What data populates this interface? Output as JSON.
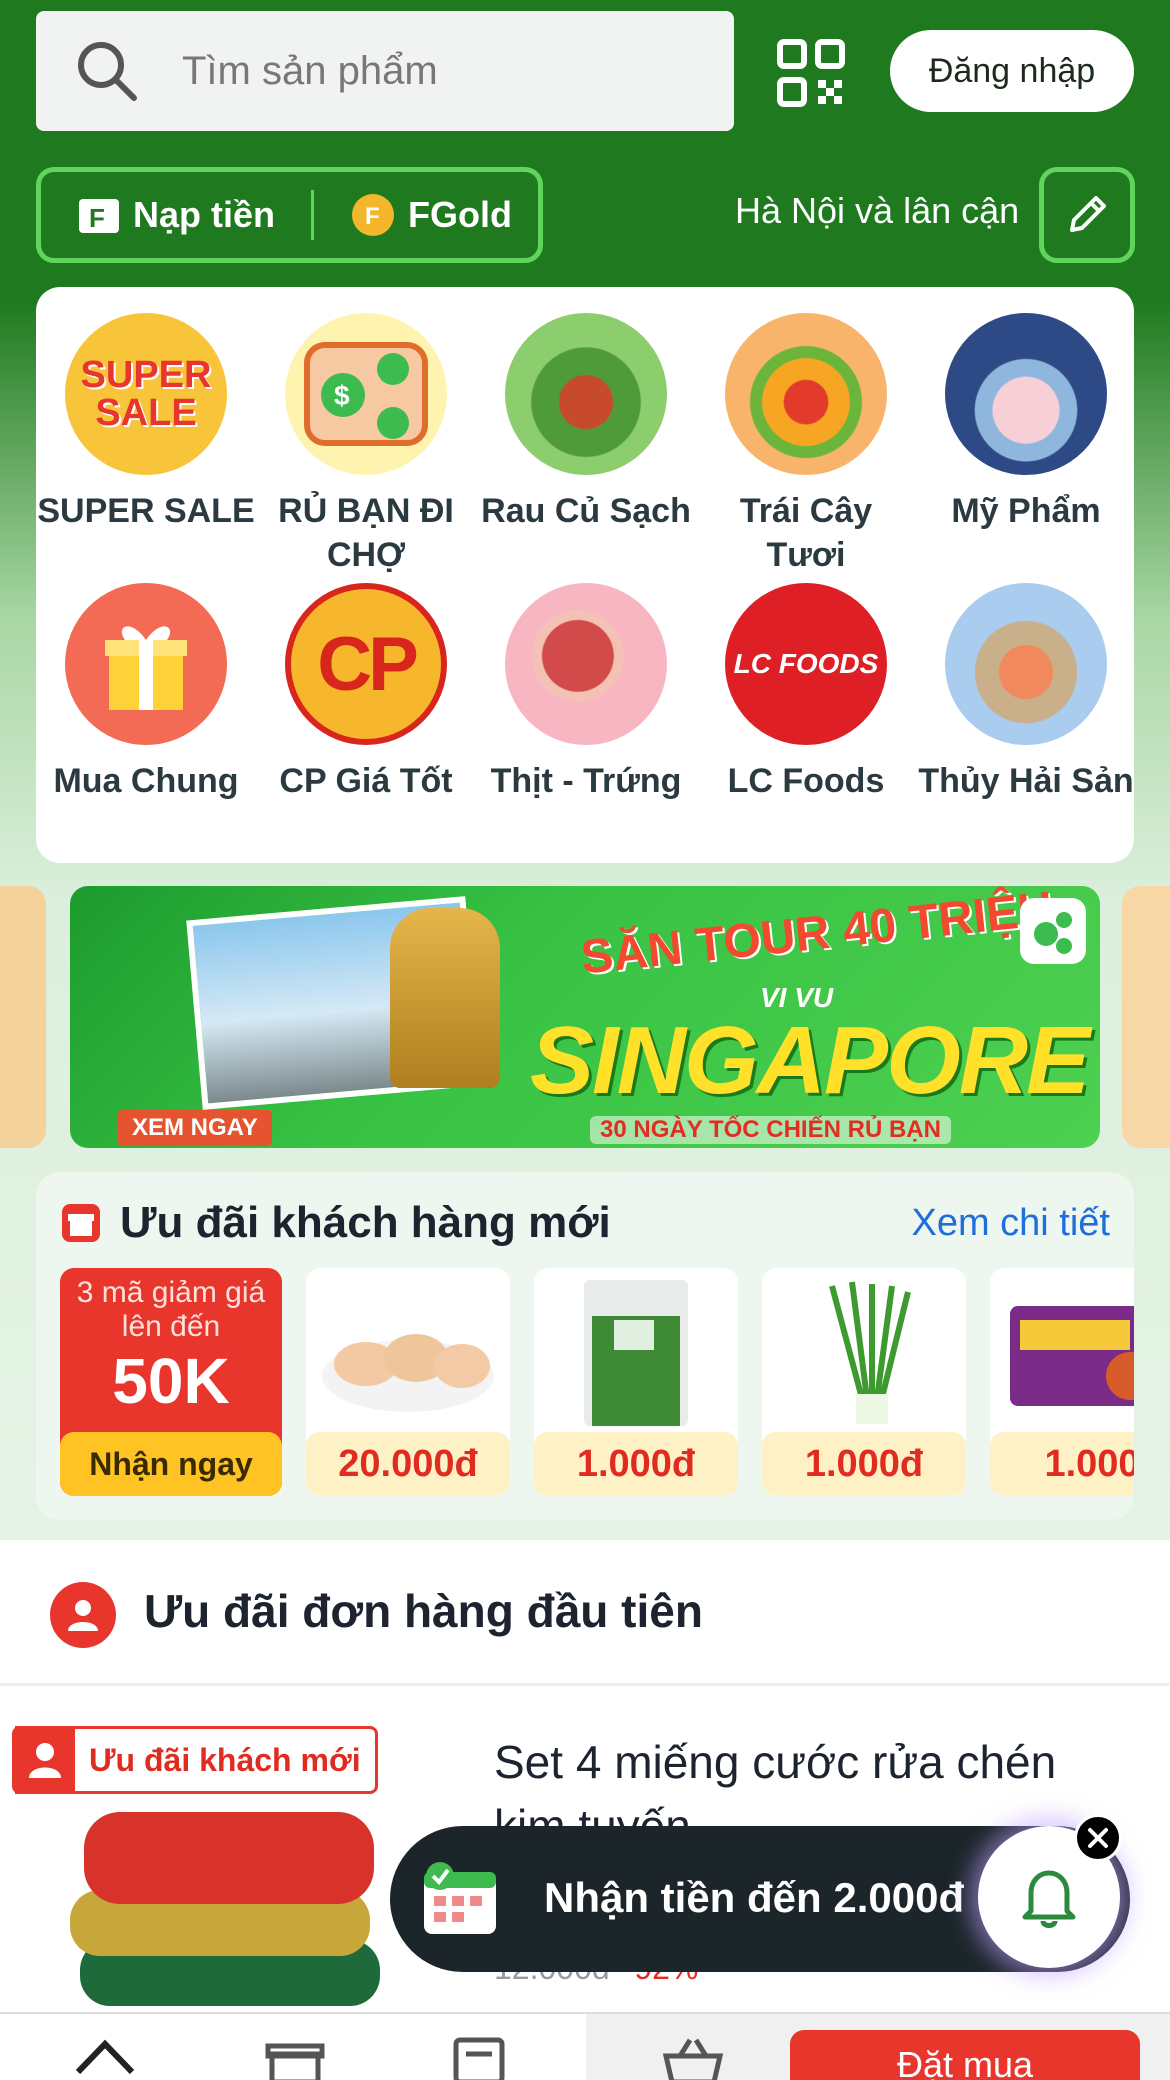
{
  "header": {
    "search_placeholder": "Tìm sản phẩm",
    "login_label": "Đăng nhập",
    "topup_label": "Nạp tiền",
    "fgold_label": "FGold",
    "region_label": "Hà Nội và lân cận"
  },
  "categories": [
    {
      "label": "SUPER SALE",
      "icon": "super-sale-icon",
      "badge": "SUPER SALE"
    },
    {
      "label": "RỦ BẠN ĐI CHỢ",
      "icon": "invite-friend-icon"
    },
    {
      "label": "Rau Củ Sạch",
      "icon": "vegetables-icon"
    },
    {
      "label": "Trái Cây Tươi",
      "icon": "fruit-icon"
    },
    {
      "label": "Mỹ Phẩm",
      "icon": "cosmetics-icon"
    },
    {
      "label": "Mua Chung",
      "icon": "gift-icon"
    },
    {
      "label": "CP Giá Tốt",
      "icon": "cp-logo-icon",
      "badge": "CP"
    },
    {
      "label": "Thịt - Trứng",
      "icon": "meat-egg-icon"
    },
    {
      "label": "LC Foods",
      "icon": "lc-foods-logo-icon",
      "badge": "LC FOODS"
    },
    {
      "label": "Thủy Hải Sản",
      "icon": "seafood-icon"
    }
  ],
  "banner": {
    "headline": "SĂN TOUR 40 TRIỆU",
    "subline": "VI VU",
    "destination": "SINGAPORE",
    "footer": "30 NGÀY TỐC CHIẾN RỦ BẠN",
    "cta": "XEM NGAY"
  },
  "new_customer": {
    "title": "Ưu đãi khách hàng mới",
    "more_label": "Xem chi tiết",
    "voucher": {
      "line1": "3 mã giảm giá lên đến",
      "amount": "50K",
      "button": "Nhận ngay"
    },
    "products": [
      {
        "price": "20.000đ",
        "image": "chicken"
      },
      {
        "price": "1.000đ",
        "image": "greens"
      },
      {
        "price": "1.000đ",
        "image": "scallion"
      },
      {
        "price": "1.000",
        "image": "seasoning"
      }
    ]
  },
  "first_order": {
    "title": "Ưu đãi đơn hàng đầu tiên",
    "tag": "Ưu đãi khách mới",
    "product_title": "Set 4 miếng cước rửa chén kim tuyến",
    "old_price": "12.000đ",
    "discount": "-92%"
  },
  "promo": {
    "text": "Nhận tiền đến 2.000đ"
  },
  "bottom_nav": {
    "order_label": "Đặt mua"
  },
  "colors": {
    "brand_green": "#1f7a1f",
    "accent_green": "#61d45d",
    "red": "#e8362d",
    "link_blue": "#1e6fd9"
  }
}
